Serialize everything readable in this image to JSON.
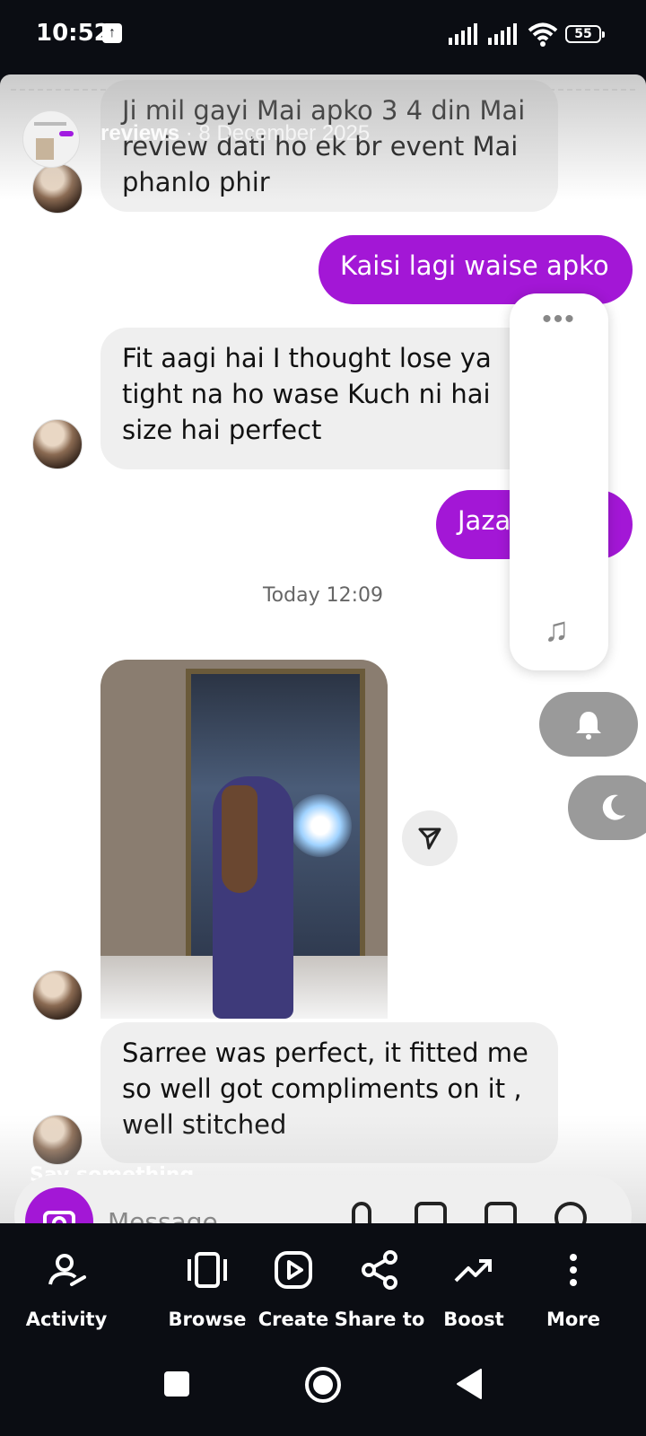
{
  "status": {
    "time": "10:52",
    "battery": "55"
  },
  "story": {
    "title": "reviews",
    "date": "8 December 2025"
  },
  "messages": [
    {
      "dir": "in",
      "text": "Ji mil gayi Mai apko 3 4 din Mai review dati ho ek br event Mai phanlo phir"
    },
    {
      "dir": "out",
      "text": "Kaisi lagi waise apko"
    },
    {
      "dir": "in",
      "text": "Fit aagi hai I thought lose ya tight na ho wase Kuch ni hai size hai perfect"
    },
    {
      "dir": "out",
      "text": "Jaza"
    },
    {
      "dir": "in",
      "text": "Sarree was perfect, it fitted me so well got compliments on it , well stitched"
    }
  ],
  "timestamp": "Today 12:09",
  "composer": {
    "hint": "Say something...",
    "placeholder": "Message"
  },
  "actions": [
    {
      "label": "Activity",
      "icon": "activity-icon"
    },
    {
      "label": "Browse",
      "icon": "browse-icon"
    },
    {
      "label": "Create",
      "icon": "create-icon"
    },
    {
      "label": "Share to",
      "icon": "share-icon"
    },
    {
      "label": "Boost",
      "icon": "boost-icon"
    },
    {
      "label": "More",
      "icon": "more-icon"
    }
  ],
  "colors": {
    "accent": "#a317d6",
    "background": "#0b0d13",
    "bubble_in": "#efefef"
  }
}
